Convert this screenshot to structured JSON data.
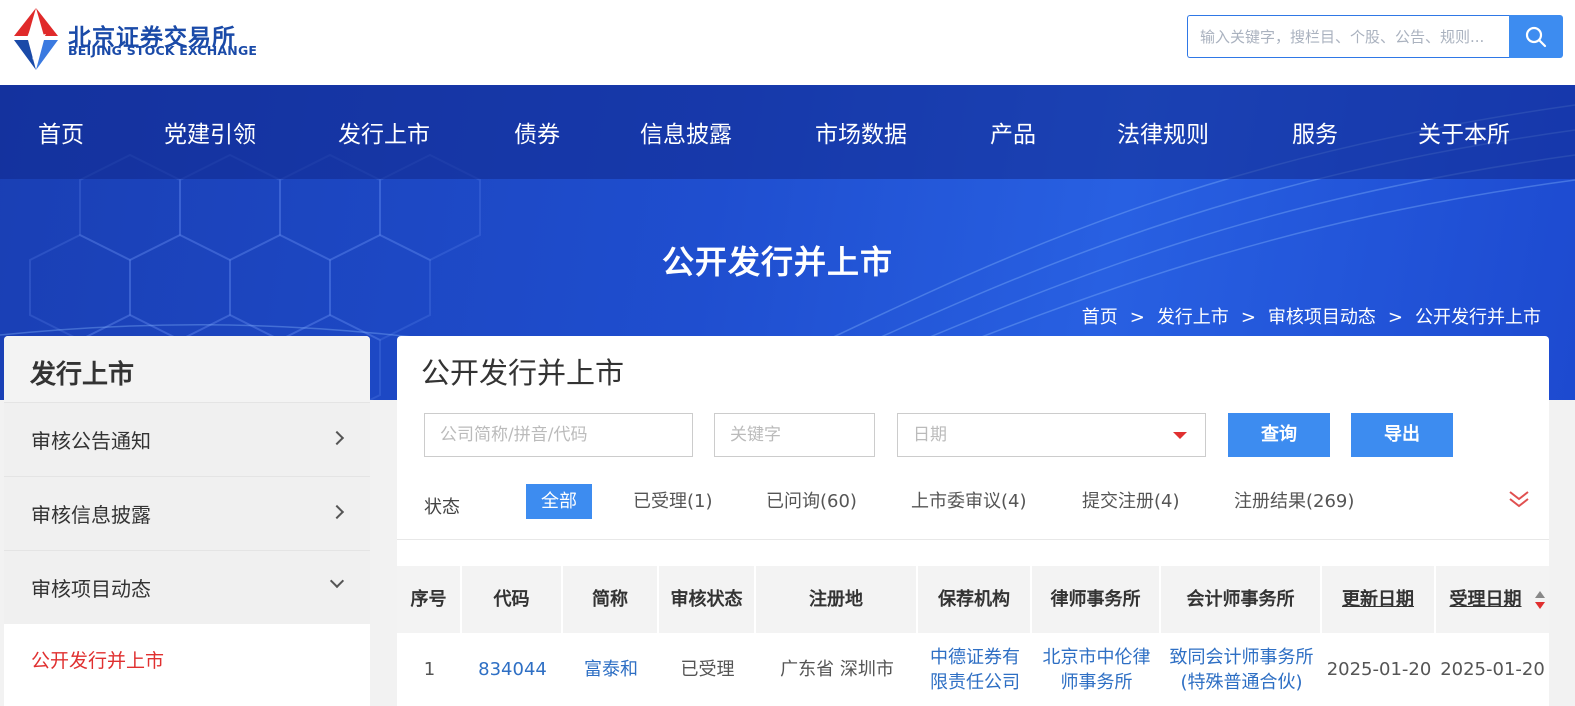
{
  "header": {
    "logo_cn": "北京证券交易所",
    "logo_en": "BEIJING STOCK EXCHANGE",
    "search_placeholder": "输入关键字，搜栏目、个股、公告、规则..."
  },
  "nav": [
    "首页",
    "党建引领",
    "发行上市",
    "债券",
    "信息披露",
    "市场数据",
    "产品",
    "法律规则",
    "服务",
    "关于本所"
  ],
  "banner": {
    "title": "公开发行并上市",
    "breadcrumb": [
      "首页",
      "发行上市",
      "审核项目动态",
      "公开发行并上市"
    ],
    "breadcrumb_sep": ">"
  },
  "sidebar": {
    "title": "发行上市",
    "items": [
      "审核公告通知",
      "审核信息披露",
      "审核项目动态"
    ],
    "active_sub": "公开发行并上市"
  },
  "main": {
    "title": "公开发行并上市",
    "filters": {
      "company_placeholder": "公司简称/拼音/代码",
      "keyword_placeholder": "关键字",
      "date_placeholder": "日期",
      "query_label": "查询",
      "export_label": "导出"
    },
    "status_label": "状态",
    "status_tabs": [
      "全部",
      "已受理(1)",
      "已问询(60)",
      "上市委审议(4)",
      "提交注册(4)",
      "注册结果(269)"
    ],
    "table": {
      "headers": [
        "序号",
        "代码",
        "简称",
        "审核状态",
        "注册地",
        "保荐机构",
        "律师事务所",
        "会计师事务所",
        "更新日期",
        "受理日期"
      ],
      "rows": [
        {
          "index": "1",
          "code": "834044",
          "name": "富泰和",
          "status": "已受理",
          "location": "广东省 深圳市",
          "sponsor": [
            "中德证券有",
            "限责任公司"
          ],
          "law_firm": [
            "北京市中伦律",
            "师事务所"
          ],
          "accounting_firm": [
            "致同会计师事务所",
            "(特殊普通合伙)"
          ],
          "update_date": "2025-01-20",
          "accept_date": "2025-01-20"
        }
      ]
    }
  },
  "colors": {
    "accent": "#3d8cf0",
    "banner": "#1f4ecf",
    "active_red": "#e03030",
    "link": "#2e6fc4"
  }
}
